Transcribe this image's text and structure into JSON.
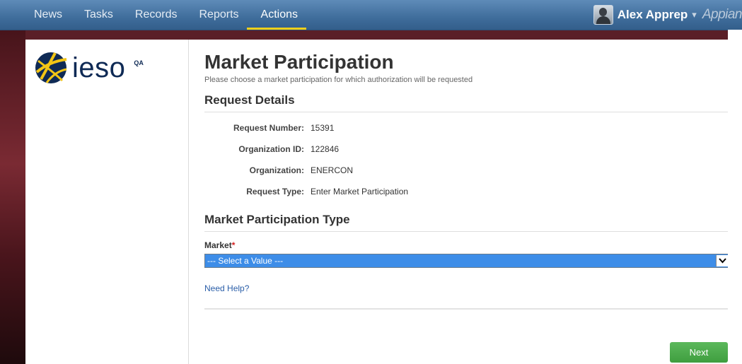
{
  "nav": {
    "items": [
      {
        "label": "News"
      },
      {
        "label": "Tasks"
      },
      {
        "label": "Records"
      },
      {
        "label": "Reports"
      },
      {
        "label": "Actions",
        "active": true
      }
    ]
  },
  "user": {
    "name": "Alex Apprep",
    "caret": "▾",
    "brand": "Appian"
  },
  "sidebar": {
    "logo_text": "ieso",
    "env_badge": "QA"
  },
  "main": {
    "title": "Market Participation",
    "subtitle": "Please choose a market participation for which authorization will be requested",
    "request_details": {
      "heading": "Request Details",
      "rows": [
        {
          "label": "Request Number:",
          "value": "15391"
        },
        {
          "label": "Organization ID:",
          "value": "122846"
        },
        {
          "label": "Organization:",
          "value": "ENERCON"
        },
        {
          "label": "Request Type:",
          "value": "Enter Market Participation"
        }
      ]
    },
    "participation_type": {
      "heading": "Market Participation Type",
      "market_label": "Market",
      "required_mark": "*",
      "selected_value": "--- Select a Value ---"
    },
    "need_help": "Need Help?",
    "next_label": "Next"
  },
  "colors": {
    "topbar": "#3f6d9b",
    "active_tab_underline": "#f2cf1a",
    "select_highlight": "#3d8de8",
    "next_button": "#4caf50",
    "link": "#2a5ea8",
    "logo_navy": "#0f2a55"
  }
}
